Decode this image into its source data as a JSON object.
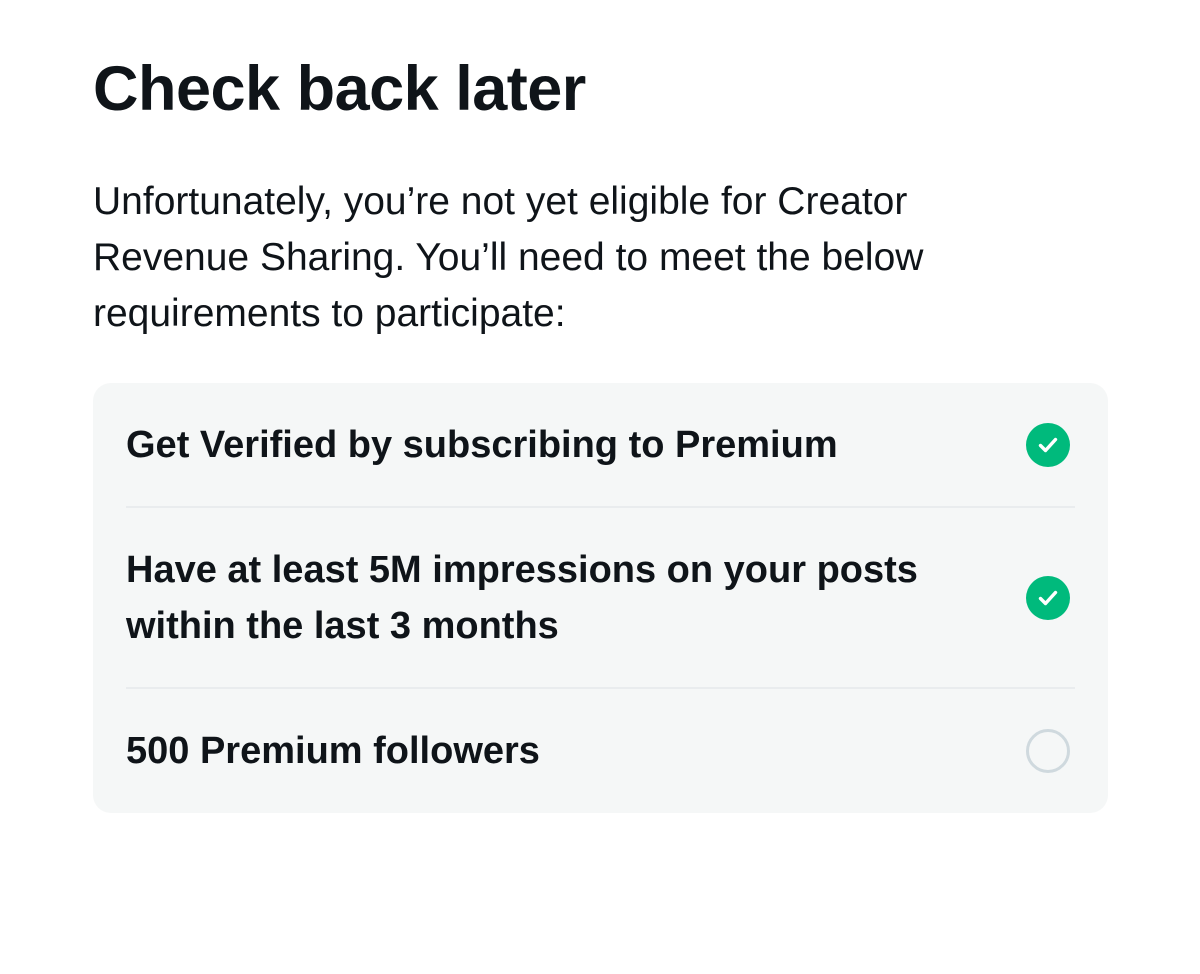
{
  "title": "Check back later",
  "description": "Unfortunately, you’re not yet eligible for Creator Revenue Sharing. You’ll need to meet the below requirements to participate:",
  "requirements": [
    {
      "label": "Get Verified by subscribing to Premium",
      "status": "met",
      "icon": "check-circle-icon"
    },
    {
      "label": "Have at least 5M impressions on your posts within the last 3 months",
      "status": "met",
      "icon": "check-circle-icon"
    },
    {
      "label": "500 Premium followers",
      "status": "unmet",
      "icon": "empty-circle-icon"
    }
  ],
  "colors": {
    "text": "#0f1419",
    "card_background": "#f5f7f7",
    "divider": "#e9ecee",
    "check_green": "#00ba7c",
    "unmet_circle": "#cfd9de"
  }
}
